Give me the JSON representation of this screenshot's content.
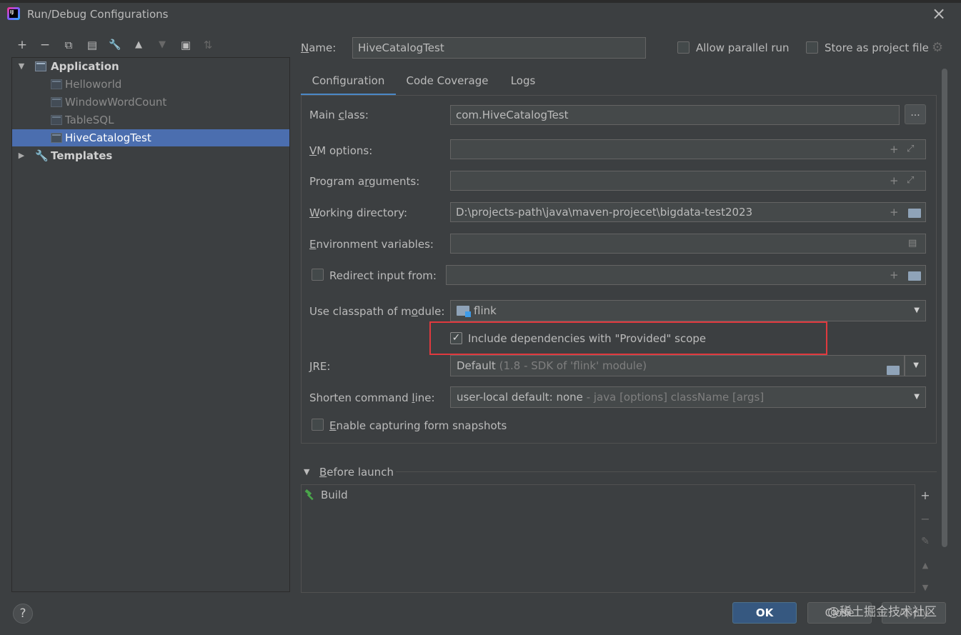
{
  "window": {
    "title": "Run/Debug Configurations",
    "app_logo_text": "IJ",
    "close_glyph": "×"
  },
  "toolbar": {
    "add": "+",
    "remove": "−",
    "copy": "⧉",
    "save": "▤",
    "edit": "🔧",
    "up": "▲",
    "down": "▼",
    "folder": "▣",
    "sort": "⇅"
  },
  "tree": {
    "application_label": "Application",
    "items": [
      {
        "label": "Helloworld"
      },
      {
        "label": "WindowWordCount"
      },
      {
        "label": "TableSQL"
      },
      {
        "label": "HiveCatalogTest"
      }
    ],
    "templates_label": "Templates",
    "selected_index": 3
  },
  "header": {
    "name_label": "Name:",
    "name_value": "HiveCatalogTest",
    "allow_parallel_label": "Allow parallel run",
    "allow_parallel_checked": false,
    "store_project_label": "Store as project file",
    "store_project_checked": false
  },
  "tabs": [
    {
      "label": "Configuration",
      "active": true
    },
    {
      "label": "Code Coverage",
      "active": false
    },
    {
      "label": "Logs",
      "active": false
    }
  ],
  "form": {
    "main_class_label": "Main class:",
    "main_class_value": "com.HiveCatalogTest",
    "browse_label": "...",
    "vm_options_label": "VM options:",
    "vm_options_value": "",
    "program_args_label": "Program arguments:",
    "program_args_value": "",
    "working_dir_label": "Working directory:",
    "working_dir_value": "D:\\projects-path\\java\\maven-projecet\\bigdata-test2023",
    "env_vars_label": "Environment variables:",
    "env_vars_value": "",
    "redirect_label": "Redirect input from:",
    "redirect_checked": false,
    "redirect_value": "",
    "classpath_label": "Use classpath of module:",
    "classpath_value": "flink",
    "include_provided_label": "Include dependencies with \"Provided\" scope",
    "include_provided_checked": true,
    "jre_label": "JRE:",
    "jre_value": "Default",
    "jre_hint": "(1.8 - SDK of 'flink' module)",
    "shorten_label": "Shorten command line:",
    "shorten_value": "user-local default: none",
    "shorten_hint": "- java [options] className [args]",
    "snapshots_label": "Enable capturing form snapshots",
    "snapshots_checked": false
  },
  "before_launch": {
    "label": "Before launch",
    "items": [
      {
        "label": "Build"
      }
    ]
  },
  "buttons": {
    "ok": "OK",
    "close": "Close",
    "apply": "Apply",
    "help": "?"
  },
  "watermark": "@稀土掘金技术社区",
  "colors": {
    "background": "#3c3f41",
    "selection": "#4b6eaf",
    "tab_underline": "#4a88c7",
    "highlight_box": "#e0393e",
    "ok_button": "#365880",
    "build_icon": "#4aa54a"
  }
}
